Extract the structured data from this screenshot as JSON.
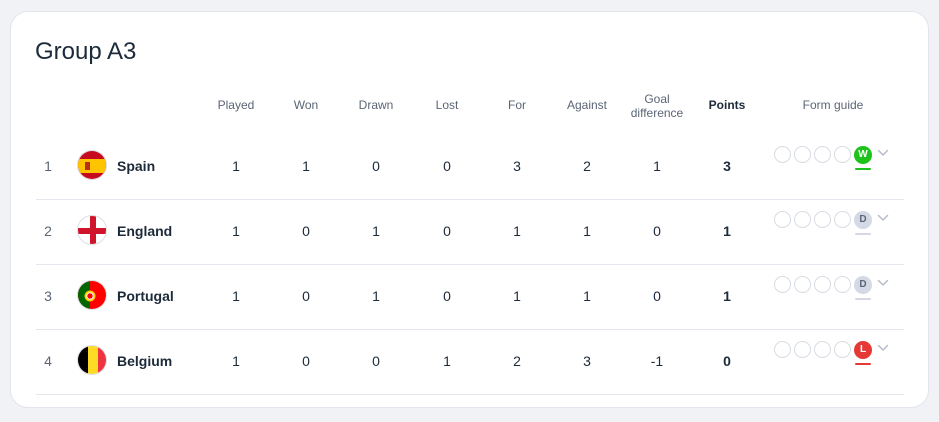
{
  "group_title": "Group A3",
  "headers": {
    "played": "Played",
    "won": "Won",
    "drawn": "Drawn",
    "lost": "Lost",
    "for": "For",
    "against": "Against",
    "goal_difference_1": "Goal",
    "goal_difference_2": "difference",
    "points": "Points",
    "form_guide": "Form guide"
  },
  "rows": [
    {
      "pos": "1",
      "team": "Spain",
      "flag": "spain-flag-icon",
      "played": "1",
      "won": "1",
      "drawn": "0",
      "lost": "0",
      "for": "3",
      "against": "2",
      "gd": "1",
      "points": "3",
      "form": "W",
      "form_color": "#1fc21a"
    },
    {
      "pos": "2",
      "team": "England",
      "flag": "england-flag-icon",
      "played": "1",
      "won": "0",
      "drawn": "1",
      "lost": "0",
      "for": "1",
      "against": "1",
      "gd": "0",
      "points": "1",
      "form": "D",
      "form_color": "#d5d9e6"
    },
    {
      "pos": "3",
      "team": "Portugal",
      "flag": "portugal-flag-icon",
      "played": "1",
      "won": "0",
      "drawn": "1",
      "lost": "0",
      "for": "1",
      "against": "1",
      "gd": "0",
      "points": "1",
      "form": "D",
      "form_color": "#d5d9e6"
    },
    {
      "pos": "4",
      "team": "Belgium",
      "flag": "belgium-flag-icon",
      "played": "1",
      "won": "0",
      "drawn": "0",
      "lost": "1",
      "for": "2",
      "against": "3",
      "gd": "-1",
      "points": "0",
      "form": "L",
      "form_color": "#e53935"
    }
  ]
}
